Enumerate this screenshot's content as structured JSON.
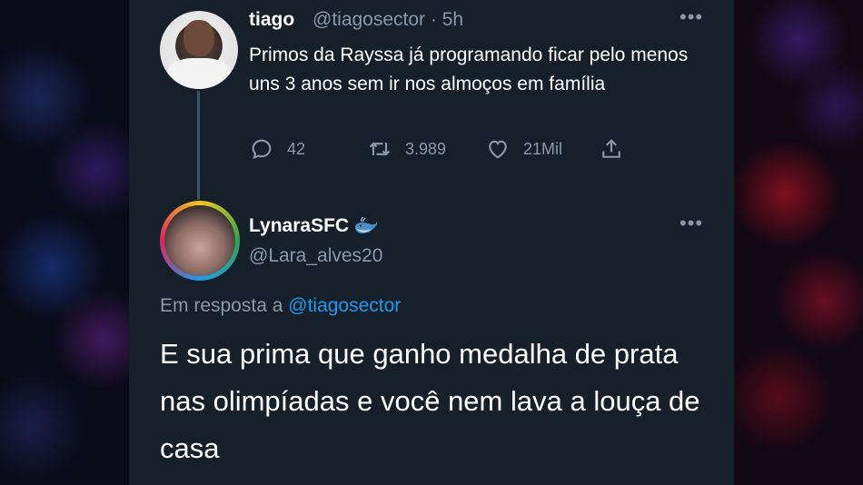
{
  "tweet": {
    "author_name": "tiago",
    "author_handle": "@tiagosector",
    "separator": "·",
    "time": "5h",
    "text": "Primos da Rayssa já programando ficar pelo menos uns 3 anos sem ir nos almoços em família",
    "replies_count": "42",
    "retweets_count": "3.989",
    "likes_count": "21Mil",
    "more_icon": "more-horizontal-icon"
  },
  "reply": {
    "author_name": "LynaraSFC",
    "author_emoji_icon": "whale-icon",
    "author_handle": "@Lara_alves20",
    "replying_to_prefix": "Em resposta a",
    "replying_to_handle": "@tiagosector",
    "text": "E sua prima que ganho medalha de prata nas olimpíadas e você nem lava a louça de casa"
  },
  "colors": {
    "background": "#15202b",
    "text_primary": "#ffffff",
    "text_secondary": "#8b98a5",
    "accent": "#1d9bf0"
  }
}
